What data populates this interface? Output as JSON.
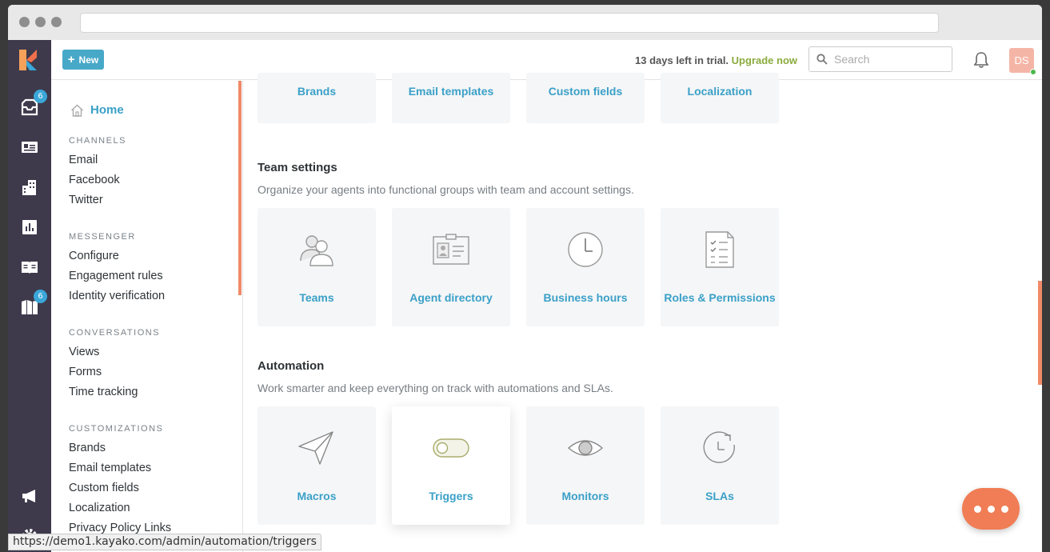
{
  "topbar": {
    "new_label": "New",
    "trial_days": "13 days left in trial.",
    "upgrade_label": "Upgrade now",
    "search_placeholder": "Search",
    "avatar_initials": "DS"
  },
  "rail": {
    "inbox_badge": "6",
    "insights_badge": "6"
  },
  "sidebar": {
    "home": "Home",
    "sections": [
      {
        "title": "CHANNELS",
        "items": [
          "Email",
          "Facebook",
          "Twitter"
        ]
      },
      {
        "title": "MESSENGER",
        "items": [
          "Configure",
          "Engagement rules",
          "Identity verification"
        ]
      },
      {
        "title": "CONVERSATIONS",
        "items": [
          "Views",
          "Forms",
          "Time tracking"
        ]
      },
      {
        "title": "CUSTOMIZATIONS",
        "items": [
          "Brands",
          "Email templates",
          "Custom fields",
          "Localization",
          "Privacy Policy Links"
        ]
      }
    ]
  },
  "main": {
    "customization_cards": [
      "Brands",
      "Email templates",
      "Custom fields",
      "Localization"
    ],
    "team": {
      "heading": "Team settings",
      "desc": "Organize your agents into functional groups with team and account settings.",
      "cards": [
        "Teams",
        "Agent directory",
        "Business hours",
        "Roles & Permissions"
      ]
    },
    "automation": {
      "heading": "Automation",
      "desc": "Work smarter and keep everything on track with automations and SLAs.",
      "cards": [
        "Macros",
        "Triggers",
        "Monitors",
        "SLAs"
      ]
    }
  },
  "status_bar": {
    "url": "https://demo1.kayako.com/admin/automation/triggers"
  },
  "colors": {
    "accent": "#3aa0c8",
    "rail": "#3e3a4c",
    "upgrade": "#8bab3e",
    "chat": "#f07d55"
  }
}
